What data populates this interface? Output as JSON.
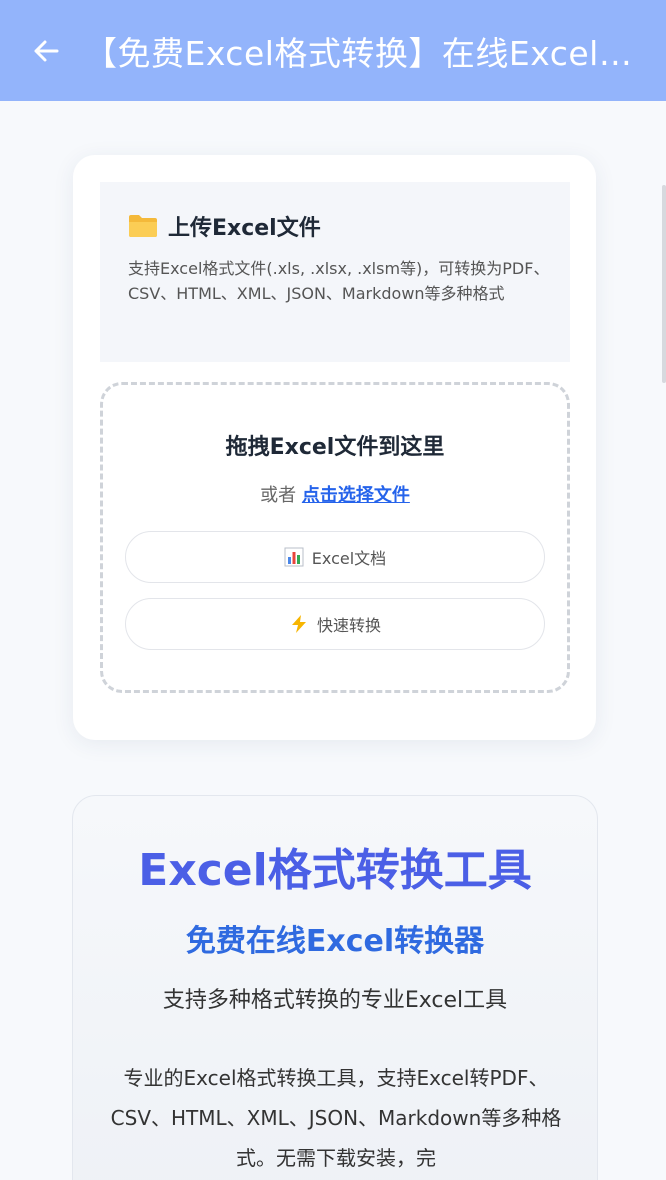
{
  "appbar": {
    "title": "【免费Excel格式转换】在线Excel格式转换工具"
  },
  "upload": {
    "title": "上传Excel文件",
    "description": "支持Excel格式文件(.xls, .xlsx, .xlsm等)，可转换为PDF、CSV、HTML、XML、JSON、Markdown等多种格式",
    "drop_title": "拖拽Excel文件到这里",
    "or_text": "或者",
    "pick_link": "点击选择文件",
    "pill1_label": "Excel文档",
    "pill2_label": "快速转换"
  },
  "info": {
    "title": "Excel格式转换工具",
    "subtitle": "免费在线Excel转换器",
    "tagline": "支持多种格式转换的专业Excel工具",
    "description": "专业的Excel格式转换工具，支持Excel转PDF、CSV、HTML、XML、JSON、Markdown等多种格式。无需下载安装，完"
  },
  "icons": {
    "back": "arrow-left-icon",
    "folder": "folder-icon",
    "chart": "bar-chart-icon",
    "bolt": "lightning-icon"
  },
  "colors": {
    "appbar": "#93b4fb",
    "accent_blue": "#2563eb",
    "title_gradient": "#4b5fe6"
  }
}
